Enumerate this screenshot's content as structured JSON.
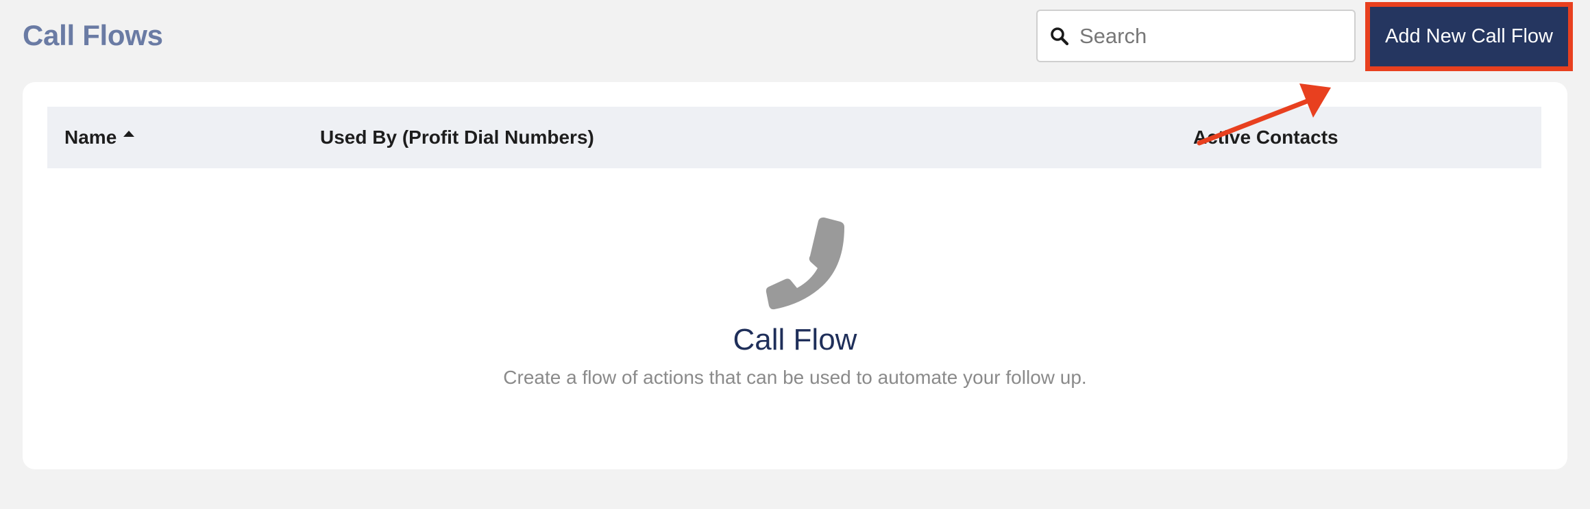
{
  "header": {
    "title": "Call Flows",
    "search_placeholder": "Search",
    "add_button_label": "Add New Call Flow"
  },
  "table": {
    "columns": [
      {
        "label": "Name",
        "sorted": "ascending"
      },
      {
        "label": "Used By (Profit Dial Numbers)"
      },
      {
        "label": "Active Contacts"
      }
    ]
  },
  "empty_state": {
    "icon": "phone-icon",
    "title": "Call Flow",
    "description": "Create a flow of actions that can be used to automate your follow up."
  },
  "colors": {
    "title": "#6a7ba4",
    "button_bg": "#253660",
    "highlight": "#e8401f",
    "empty_title": "#1f2f5a"
  }
}
